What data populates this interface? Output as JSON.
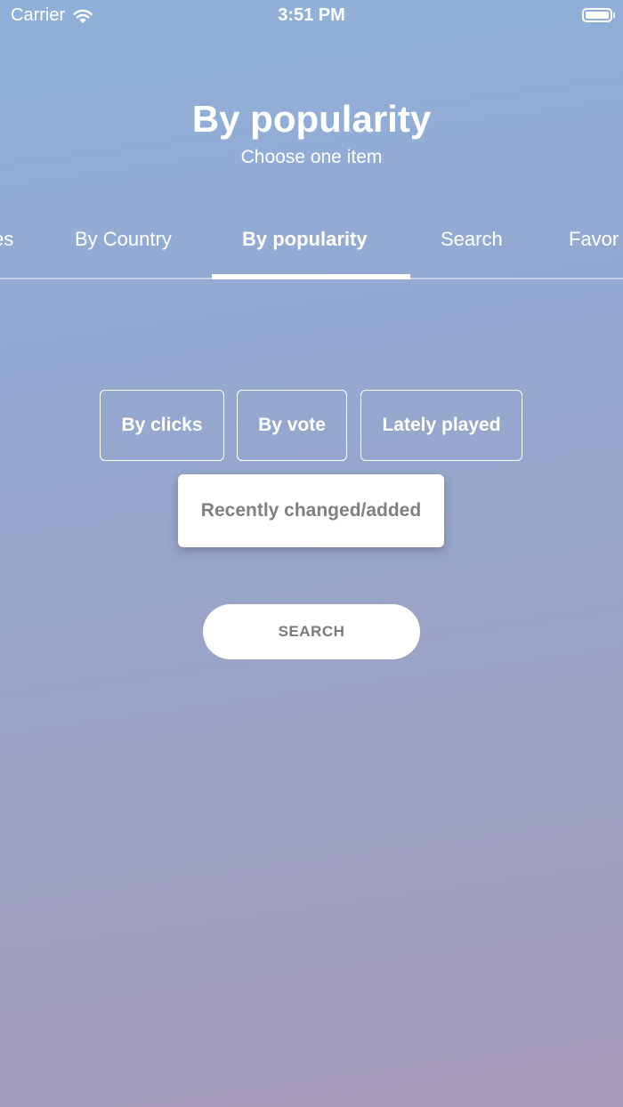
{
  "status_bar": {
    "carrier": "Carrier",
    "time": "3:51 PM"
  },
  "header": {
    "title": "By popularity",
    "subtitle": "Choose one item"
  },
  "tabs": [
    {
      "label": "es"
    },
    {
      "label": "By Country"
    },
    {
      "label": "By popularity"
    },
    {
      "label": "Search"
    },
    {
      "label": "Favor"
    }
  ],
  "active_tab": "By popularity",
  "filters": [
    {
      "label": "By clicks"
    },
    {
      "label": "By vote"
    },
    {
      "label": "Lately played"
    },
    {
      "label": "Recently changed/added"
    }
  ],
  "selected_filter": "Recently changed/added",
  "search_button": {
    "label": "SEARCH"
  },
  "colors": {
    "gradient_top": "#8fb1d9",
    "gradient_bottom": "#a49ab7",
    "selected_text": "#808080"
  }
}
